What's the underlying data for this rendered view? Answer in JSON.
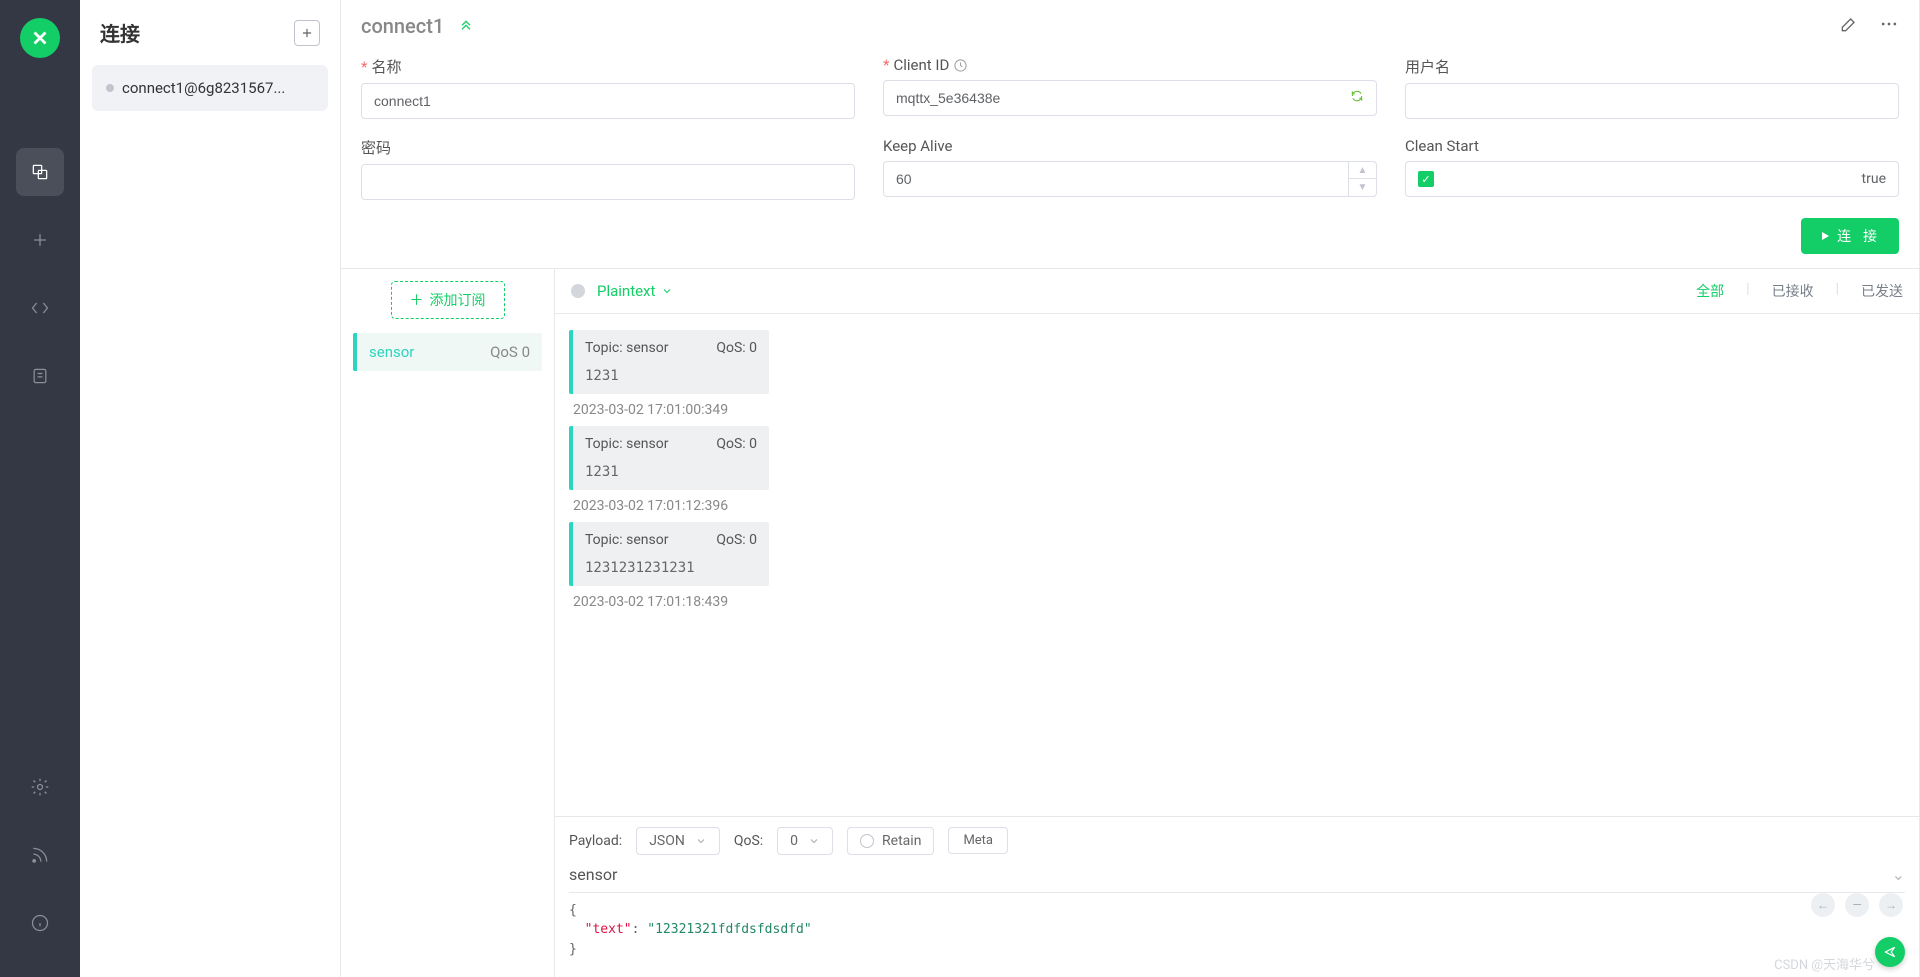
{
  "sidebar": {
    "title": "连接",
    "connection_item": "connect1@6g8231567..."
  },
  "header": {
    "name": "connect1",
    "fields": {
      "name_label": "名称",
      "name_value": "connect1",
      "clientid_label": "Client ID",
      "clientid_value": "mqttx_5e36438e",
      "username_label": "用户名",
      "password_label": "密码",
      "keepalive_label": "Keep Alive",
      "keepalive_value": "60",
      "cleanstart_label": "Clean Start",
      "cleanstart_value": "true"
    },
    "connect_btn": "连 接"
  },
  "subs": {
    "add_label": "添加订阅",
    "items": [
      {
        "topic": "sensor",
        "qos": "QoS 0"
      }
    ]
  },
  "messages": {
    "format": "Plaintext",
    "filters": {
      "all": "全部",
      "received": "已接收",
      "sent": "已发送"
    },
    "list": [
      {
        "topic": "Topic: sensor",
        "qos": "QoS: 0",
        "payload": "1231",
        "time": "2023-03-02 17:01:00:349"
      },
      {
        "topic": "Topic: sensor",
        "qos": "QoS: 0",
        "payload": "1231",
        "time": "2023-03-02 17:01:12:396"
      },
      {
        "topic": "Topic: sensor",
        "qos": "QoS: 0",
        "payload": "1231231231231",
        "time": "2023-03-02 17:01:18:439"
      }
    ]
  },
  "publish": {
    "payload_label": "Payload:",
    "payload_type": "JSON",
    "qos_label": "QoS:",
    "qos_value": "0",
    "retain_label": "Retain",
    "meta_label": "Meta",
    "topic": "sensor",
    "json_key": "\"text\"",
    "json_val": "\"12321321fdfdsfdsdfd\""
  },
  "watermark": "CSDN @天海华兮"
}
